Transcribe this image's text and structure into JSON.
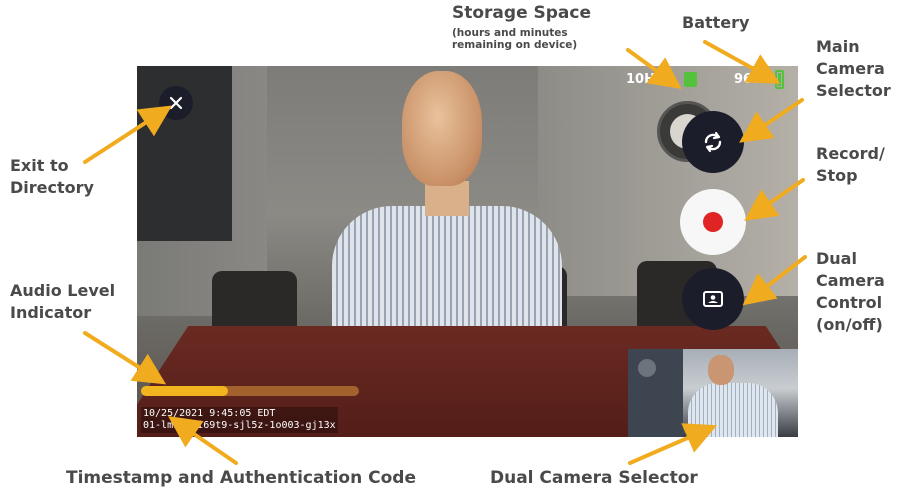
{
  "annotations": {
    "storage_title": "Storage Space",
    "storage_sub": "(hours and minutes remaining on device)",
    "battery": "Battery",
    "main_camera_selector": [
      "Main",
      "Camera",
      "Selector"
    ],
    "record_stop": [
      "Record/",
      "Stop"
    ],
    "dual_camera_control": [
      "Dual",
      "Camera",
      "Control",
      "(on/off)"
    ],
    "exit_directory": [
      "Exit to",
      "Directory"
    ],
    "audio_level": [
      "Audio Level",
      "Indicator"
    ],
    "timestamp_auth": "Timestamp and Authentication Code",
    "dual_camera_selector": "Dual Camera Selector"
  },
  "status": {
    "storage_remaining": "10H01",
    "battery_percent": "96%"
  },
  "overlay": {
    "timestamp": "10/25/2021 9:45:05 EDT",
    "auth_code": "01-lmwj0-i69t9-sjl5z-1o003-gj13x"
  },
  "audio_level": 0.4,
  "icons": {
    "exit": "close-icon",
    "switch": "camera-switch-icon",
    "record": "record-icon",
    "dual": "dual-camera-icon"
  },
  "colors": {
    "arrow": "#f0ab1e",
    "label_text": "#4a4a4a",
    "button_dark": "#1b1d2b",
    "record_red": "#e02424",
    "battery_green": "#54c23b",
    "audio_bar": "#f3b51f"
  }
}
